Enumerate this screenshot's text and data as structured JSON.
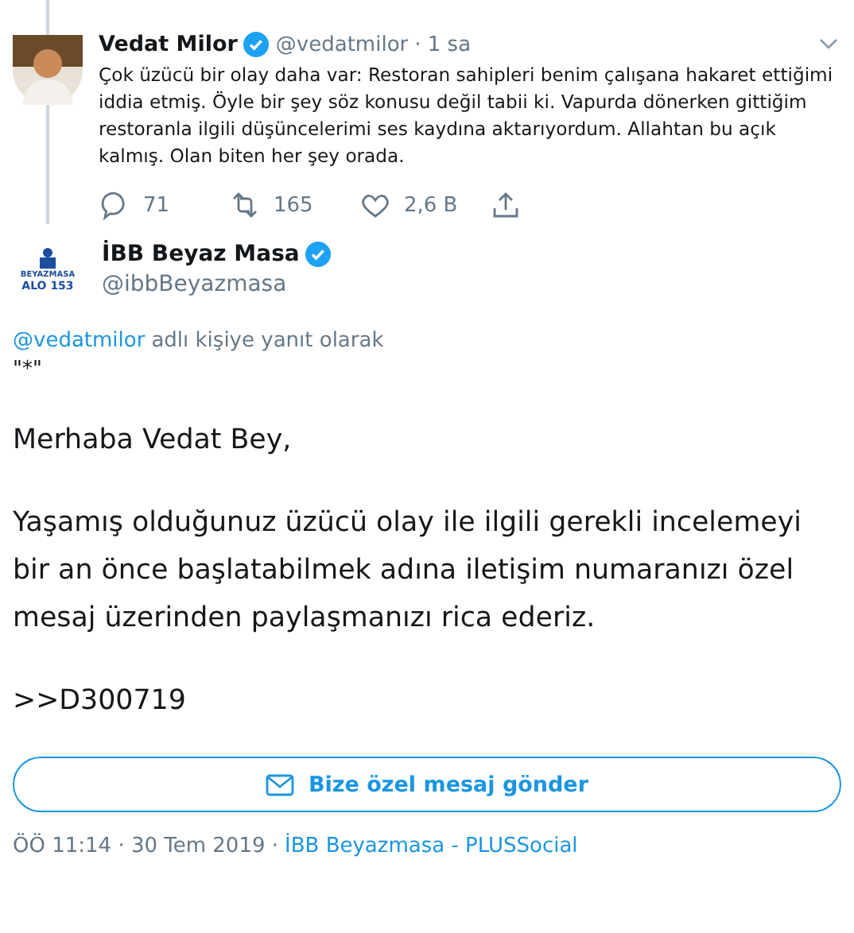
{
  "parent_tweet": {
    "name": "Vedat Milor",
    "verified": true,
    "handle": "@vedatmilor",
    "time": "· 1 sa",
    "text": "Çok üzücü bir olay daha var: Restoran sahipleri benim çalışana hakaret ettiğimi iddia etmiş. Öyle bir şey söz konusu değil tabii ki. Vapurda dönerken gittiğim restoranla ilgili düşüncelerimi ses kaydına aktarıyordum. Allahtan bu açık kalmış. Olan biten her şey orada.",
    "actions": [
      {
        "kind": "reply",
        "count": "71"
      },
      {
        "kind": "retweet",
        "count": "165"
      },
      {
        "kind": "like",
        "count": "2,6 B"
      },
      {
        "kind": "share"
      }
    ]
  },
  "reply_tweet": {
    "name": "İBB Beyaz Masa",
    "verified": true,
    "handle": "@ibbBeyazmasa",
    "logo_lines": [
      "BEYAZMASA",
      "ALO 153"
    ],
    "reply_to": {
      "mention": "@vedatmilor",
      "suffix": "adlı kişiye yanıt olarak"
    },
    "paragraphs": [
      "\"*\""
    ],
    "large_paragraphs": [
      "Merhaba Vedat Bey,",
      "Yaşamış olduğunuz üzücü olay ile ilgili gerekli incelemeyi bir an önce başlatabilmek adına iletişim numaranızı özel mesaj üzerinden paylaşmanızı rica ederiz.",
      ">>D300719"
    ],
    "dm_button": "Bize özel mesaj gönder",
    "timestamp": "ÖÖ 11:14 · 30 Tem 2019 ·",
    "source": "İBB Beyazmasa - PLUSSocial"
  }
}
